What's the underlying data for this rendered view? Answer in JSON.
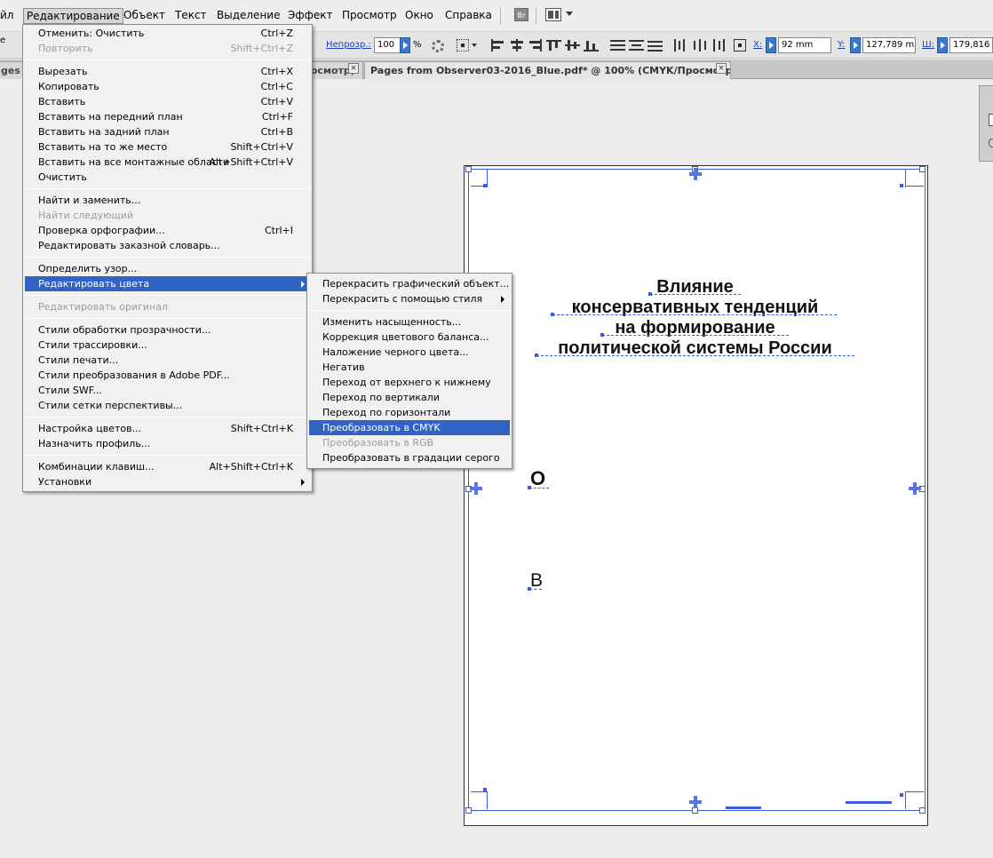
{
  "menubar": {
    "items": [
      "йл",
      "Редактирование",
      "Объект",
      "Текст",
      "Выделение",
      "Эффект",
      "Просмотр",
      "Окно",
      "Справка"
    ],
    "bridge_label": "Br"
  },
  "control_bar": {
    "left_fragment": "е",
    "opacity_label": "Непрозр.:",
    "opacity_value": "100",
    "opacity_unit": "%",
    "x_label": "X:",
    "x_value": "92 mm",
    "y_label": "Y:",
    "y_value": "127,789 mm",
    "w_label": "Ш:",
    "w_value": "179,816 m"
  },
  "tabs": [
    {
      "label": "ges f",
      "close": "×"
    },
    {
      "label": "росмотр)",
      "close": "×"
    },
    {
      "label": "Pages from Observer03-2016_Blue.pdf* @ 100% (CMYK/Просмотр)",
      "close": "×"
    }
  ],
  "edit_menu": {
    "rows": [
      {
        "label": "Отменить: Очистить",
        "shortcut": "Ctrl+Z",
        "state": "normal"
      },
      {
        "label": "Повторить",
        "shortcut": "Shift+Ctrl+Z",
        "state": "disabled"
      },
      {
        "label": "Вырезать",
        "shortcut": "Ctrl+X",
        "state": "normal"
      },
      {
        "label": "Копировать",
        "shortcut": "Ctrl+C",
        "state": "normal"
      },
      {
        "label": "Вставить",
        "shortcut": "Ctrl+V",
        "state": "normal"
      },
      {
        "label": "Вставить на передний план",
        "shortcut": "Ctrl+F",
        "state": "normal"
      },
      {
        "label": "Вставить на задний план",
        "shortcut": "Ctrl+B",
        "state": "normal"
      },
      {
        "label": "Вставить на то же место",
        "shortcut": "Shift+Ctrl+V",
        "state": "normal"
      },
      {
        "label": "Вставить на все монтажные области",
        "shortcut": "Alt+Shift+Ctrl+V",
        "state": "normal"
      },
      {
        "label": "Очистить",
        "shortcut": "",
        "state": "normal"
      },
      {
        "label": "Найти и заменить...",
        "shortcut": "",
        "state": "normal"
      },
      {
        "label": "Найти следующий",
        "shortcut": "",
        "state": "disabled"
      },
      {
        "label": "Проверка орфографии...",
        "shortcut": "Ctrl+I",
        "state": "normal"
      },
      {
        "label": "Редактировать заказной словарь...",
        "shortcut": "",
        "state": "normal"
      },
      {
        "label": "Определить узор...",
        "shortcut": "",
        "state": "normal"
      },
      {
        "label": "Редактировать цвета",
        "shortcut": "",
        "state": "highlighted",
        "submenu": true
      },
      {
        "label": "Редактировать оригинал",
        "shortcut": "",
        "state": "disabled"
      },
      {
        "label": "Стили обработки прозрачности...",
        "shortcut": "",
        "state": "normal"
      },
      {
        "label": "Стили трассировки...",
        "shortcut": "",
        "state": "normal"
      },
      {
        "label": "Стили печати...",
        "shortcut": "",
        "state": "normal"
      },
      {
        "label": "Стили преобразования в Adobe PDF...",
        "shortcut": "",
        "state": "normal"
      },
      {
        "label": "Стили SWF...",
        "shortcut": "",
        "state": "normal"
      },
      {
        "label": "Стили сетки перспективы...",
        "shortcut": "",
        "state": "normal"
      },
      {
        "label": "Настройка цветов...",
        "shortcut": "Shift+Ctrl+K",
        "state": "normal"
      },
      {
        "label": "Назначить профиль...",
        "shortcut": "",
        "state": "normal"
      },
      {
        "label": "Комбинации клавиш...",
        "shortcut": "Alt+Shift+Ctrl+K",
        "state": "normal"
      },
      {
        "label": "Установки",
        "shortcut": "",
        "state": "normal",
        "submenu": true
      }
    ]
  },
  "colors_submenu": {
    "rows": [
      {
        "label": "Перекрасить графический объект...",
        "state": "normal"
      },
      {
        "label": "Перекрасить с помощью стиля",
        "state": "normal",
        "submenu": true
      },
      {
        "label": "Изменить насыщенность...",
        "state": "normal"
      },
      {
        "label": "Коррекция цветового баланса...",
        "state": "normal"
      },
      {
        "label": "Наложение черного цвета...",
        "state": "normal"
      },
      {
        "label": "Негатив",
        "state": "normal"
      },
      {
        "label": "Переход от верхнего к нижнему",
        "state": "normal"
      },
      {
        "label": "Переход по вертикали",
        "state": "normal"
      },
      {
        "label": "Переход по горизонтали",
        "state": "normal"
      },
      {
        "label": "Преобразовать в CMYK",
        "state": "highlighted"
      },
      {
        "label": "Преобразовать в RGB",
        "state": "disabled"
      },
      {
        "label": "Преобразовать в градации серого",
        "state": "normal"
      }
    ]
  },
  "document": {
    "title_lines": [
      "Влияние",
      "консервативных тенденций",
      "на формирование",
      "политической системы России"
    ],
    "letter_o": "О",
    "letter_v": "В"
  },
  "colors": {
    "highlight": "#3163c5",
    "selection": "#3c5be0",
    "menu_bg": "#f1f1f1",
    "disabled_text": "#9c9c9c"
  }
}
